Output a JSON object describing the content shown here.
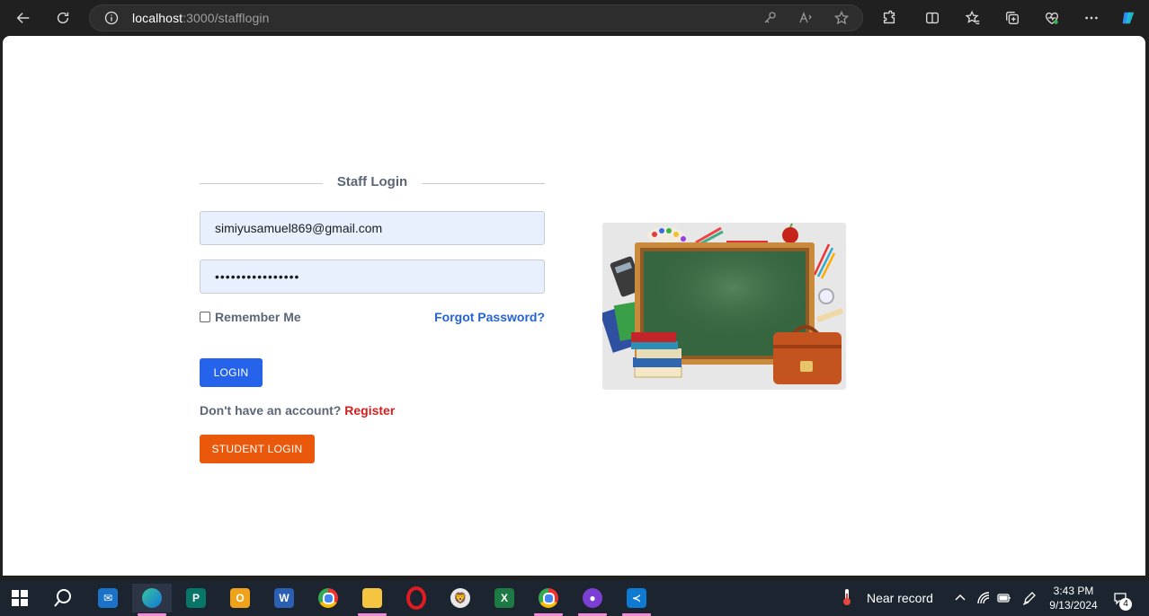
{
  "browser": {
    "url_host": "localhost",
    "url_path": ":3000/stafflogin"
  },
  "page": {
    "title": "Staff Login",
    "email_value": "simiyusamuel869@gmail.com",
    "password_masked": "••••••••••••••••",
    "remember_label": "Remember Me",
    "forgot_label": "Forgot Password?",
    "login_label": "LOGIN",
    "no_account_text": "Don't have an account?",
    "register_label": "Register",
    "student_login_label": "STUDENT LOGIN"
  },
  "taskbar": {
    "weather": "Near record",
    "time": "3:43 PM",
    "date": "9/13/2024",
    "notification_count": "4",
    "apps": [
      "start",
      "search",
      "mail",
      "edge",
      "publisher",
      "outlook",
      "word",
      "chrome",
      "file-explorer",
      "opera",
      "lion-app",
      "excel",
      "chrome-profile",
      "github-desktop",
      "vscode"
    ]
  },
  "colors": {
    "primary_button": "#2563eb",
    "student_button": "#ea580c",
    "link": "#2563d4",
    "register_link": "#d42020"
  }
}
